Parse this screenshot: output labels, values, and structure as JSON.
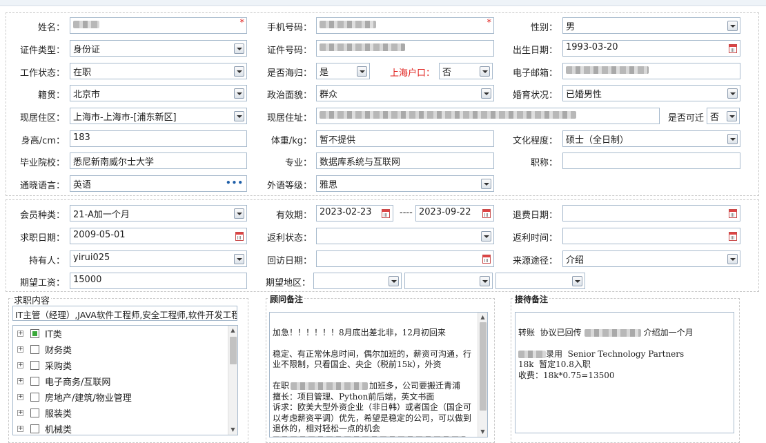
{
  "personal": {
    "name": {
      "label": "姓名："
    },
    "mobile": {
      "label": "手机号码："
    },
    "gender": {
      "label": "性别：",
      "value": "男"
    },
    "id_type": {
      "label": "证件类型：",
      "value": "身份证"
    },
    "id_number": {
      "label": "证件号码："
    },
    "birth_date": {
      "label": "出生日期：",
      "value": "1993-03-20"
    },
    "work_status": {
      "label": "工作状态：",
      "value": "在职"
    },
    "overseas_returnee": {
      "label": "是否海归：",
      "value": "是"
    },
    "shanghai_hukou": {
      "label": "上海户口：",
      "value": "否"
    },
    "email": {
      "label": "电子邮箱："
    },
    "native_place": {
      "label": "籍贯：",
      "value": "北京市"
    },
    "political_status": {
      "label": "政治面貌：",
      "value": "群众"
    },
    "marital_status": {
      "label": "婚育状况：",
      "value": "已婚男性"
    },
    "current_region": {
      "label": "现居住区：",
      "value": "上海市-上海市-[浦东新区]"
    },
    "current_address": {
      "label": "现居住址："
    },
    "relocatable": {
      "label": "是否可迁",
      "value": "否"
    },
    "height": {
      "label": "身高/cm：",
      "value": "183"
    },
    "weight": {
      "label": "体重/kg：",
      "value": "暂不提供"
    },
    "education": {
      "label": "文化程度：",
      "value": "硕士（全日制）"
    },
    "school": {
      "label": "毕业院校：",
      "value": "悉尼新南威尔士大学"
    },
    "major": {
      "label": "专业：",
      "value": "数据库系统与互联网"
    },
    "title": {
      "label": "职称：",
      "value": ""
    },
    "language": {
      "label": "通晓语言：",
      "value": "英语",
      "more": "•••"
    },
    "language_level": {
      "label": "外语等级：",
      "value": "雅思"
    }
  },
  "membership": {
    "member_type": {
      "label": "会员种类：",
      "value": "21-A加一个月"
    },
    "valid_period": {
      "label": "有效期：",
      "from": "2023-02-23",
      "sep": "----",
      "to": "2023-09-22"
    },
    "refund_date": {
      "label": "退费日期：",
      "value": ""
    },
    "job_seek_date": {
      "label": "求职日期：",
      "value": "2009-05-01"
    },
    "rebate_status": {
      "label": "返利状态：",
      "value": ""
    },
    "rebate_time": {
      "label": "返利时间：",
      "value": ""
    },
    "holder": {
      "label": "持有人：",
      "value": "yirui025"
    },
    "revisit_date": {
      "label": "回访日期：",
      "value": ""
    },
    "source": {
      "label": "来源途径：",
      "value": "介绍"
    },
    "expected_salary": {
      "label": "期望工资：",
      "value": "15000"
    },
    "expected_region": {
      "label": "期望地区：",
      "values": [
        "",
        "",
        ""
      ]
    }
  },
  "job_content": {
    "title": "求职内容",
    "summary": "IT主管（经理）,JAVA软件工程师,安全工程师,软件开发工程",
    "categories": [
      {
        "label": "IT类",
        "checked": true
      },
      {
        "label": "财务类",
        "checked": false
      },
      {
        "label": "采购类",
        "checked": false
      },
      {
        "label": "电子商务/互联网",
        "checked": false
      },
      {
        "label": "房地产/建筑/物业管理",
        "checked": false
      },
      {
        "label": "服装类",
        "checked": false
      },
      {
        "label": "机械类",
        "checked": false
      }
    ]
  },
  "advisor_notes": {
    "title": "顾问备注",
    "p1": "加急！！！！！！8月底出差北非，12月初回来",
    "p2": "稳定、有正常休息时间，偶尔加班的，薪资可沟通，行业不限制，只看国企、央企（税前15k），外资",
    "p3_a": "在职",
    "p3_b": "加班多，公司要搬迁青浦",
    "p4": "擅长：项目管理、Python前后端，英文书面",
    "p5": "诉求：欧美大型外资企业（非日韩）或者国企（国企可以考虑薪资平调）优先，希望是稳定的公司，可以做到退休的，相对轻松一点的机会"
  },
  "reception_notes": {
    "title": "接待备注",
    "l1_a": "转账  协议已回传",
    "l1_b": "介绍加一个月",
    "l2": "录用  Senior Technology Partners",
    "l3": "18k  暂定10.8入职",
    "l4": "收费：18k*0.75=13500"
  }
}
